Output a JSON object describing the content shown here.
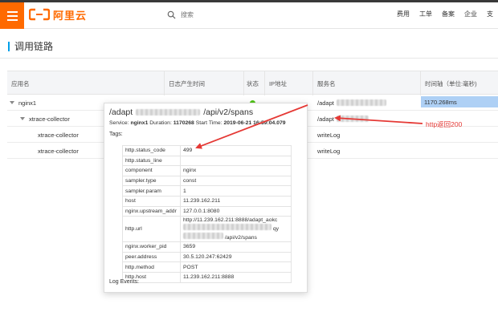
{
  "topbar": {
    "logo_text": "阿里云",
    "search_placeholder": "搜索",
    "nav": [
      "费用",
      "工单",
      "备案",
      "企业",
      "支"
    ]
  },
  "page_title": "调用链路",
  "table": {
    "headers": [
      "应用名",
      "日志产生时间",
      "状态",
      "IP地址",
      "服务名",
      "时间轴（单位:毫秒)"
    ],
    "rows": [
      {
        "app": "nginx1",
        "service": "/adapt",
        "duration": "1170.268ms"
      },
      {
        "app": "xtrace-collector",
        "service": "/adapt"
      },
      {
        "app": "xtrace-collector",
        "service": "writeLog"
      },
      {
        "app": "xtrace-collector",
        "service": "writeLog"
      }
    ]
  },
  "tooltip": {
    "title_prefix": "/adapt",
    "title_suffix": "/api/v2/spans",
    "service_label": "Service:",
    "service_value": "nginx1",
    "duration_label": "Duration:",
    "duration_value": "1170268",
    "start_label": "Start Time:",
    "start_value": "2019-06-21 16:59:04.079",
    "tags_label": "Tags:",
    "tags": [
      {
        "key": "http.status_code",
        "value": "499"
      },
      {
        "key": "http.status_line",
        "value": ""
      },
      {
        "key": "component",
        "value": "nginx"
      },
      {
        "key": "sampler.type",
        "value": "const"
      },
      {
        "key": "sampler.param",
        "value": "1"
      },
      {
        "key": "host",
        "value": "11.239.162.211"
      },
      {
        "key": "nginx.upstream_addr",
        "value": "127.0.0.1:8080"
      },
      {
        "key": "http.url",
        "value_line1": "http://11.239.162.211:8888/adapt_aokc",
        "value_line2": "qy",
        "value_line3": "/api/v2/spans"
      },
      {
        "key": "nginx.worker_pid",
        "value": "3659"
      },
      {
        "key": "peer.address",
        "value": "30.5.120.247:62429"
      },
      {
        "key": "http.method",
        "value": "POST"
      },
      {
        "key": "http.host",
        "value": "11.239.162.211:8888"
      }
    ],
    "log_events_label": "Log Events:"
  },
  "annotation": "http返回200",
  "colors": {
    "brand": "#ff6a00",
    "accent": "#00a0e9",
    "annotation": "#e53935",
    "duration_bar": "#aed0f5"
  }
}
